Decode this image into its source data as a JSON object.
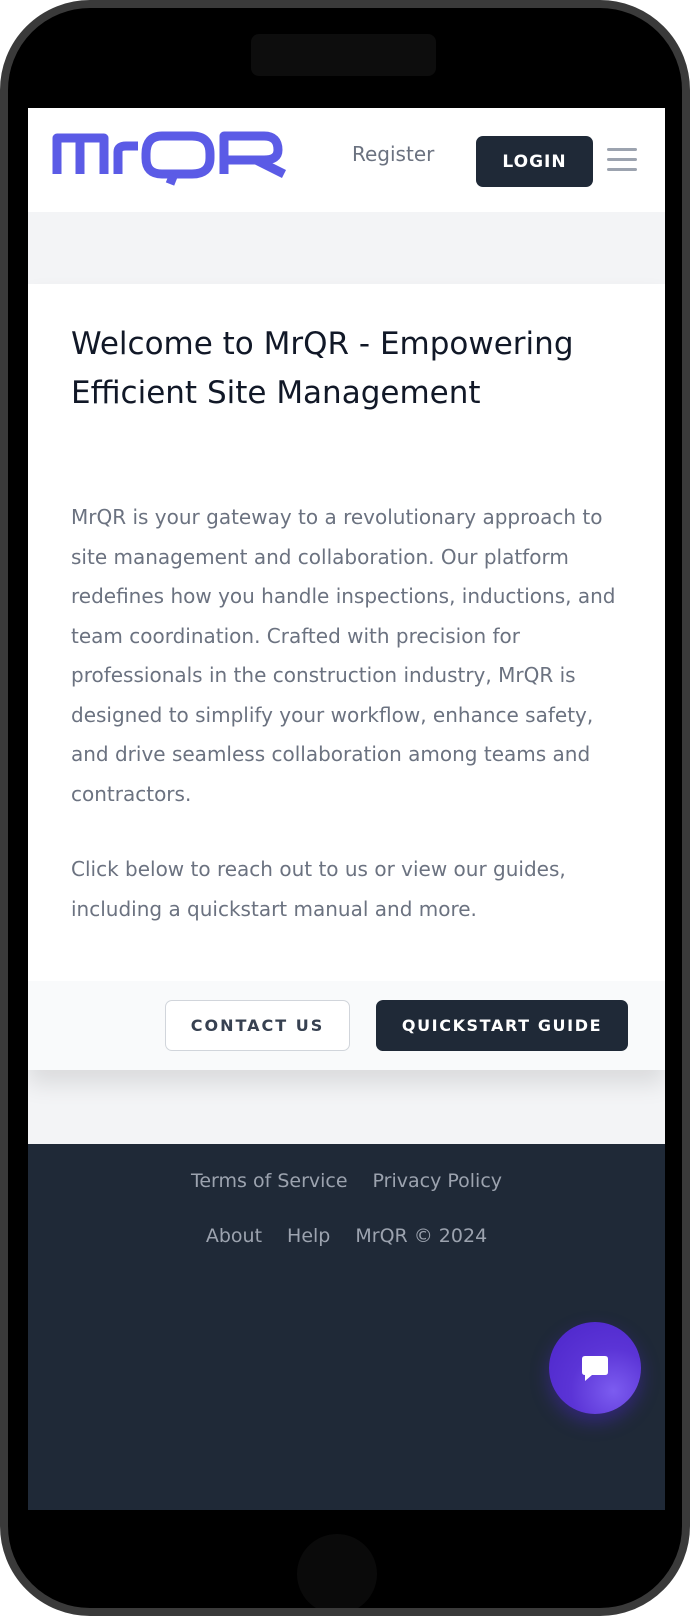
{
  "header": {
    "logo_text": "MrQR",
    "register_label": "Register",
    "login_label": "LOGIN",
    "menu_icon": "hamburger-menu-icon"
  },
  "card": {
    "title": "Welcome to MrQR - Empowering Efficient Site Management",
    "body": "MrQR is your gateway to a revolutionary approach to site management and collaboration. Our platform redefines how you handle inspections, inductions, and team coordination. Crafted with precision for professionals in the construction industry, MrQR is designed to simplify your workflow, enhance safety, and drive seamless collaboration among teams and contractors.",
    "cta_text": "Click below to reach out to us or view our guides, including a quickstart manual and more.",
    "contact_label": "CONTACT US",
    "quickstart_label": "QUICKSTART GUIDE"
  },
  "footer": {
    "links_row1": [
      "Terms of Service",
      "Privacy Policy"
    ],
    "links_row2": [
      "About",
      "Help"
    ],
    "copyright": "MrQR © 2024"
  },
  "chat": {
    "icon": "chat-bubble-icon"
  },
  "colors": {
    "brand": "#5b5be6",
    "dark": "#1f2937",
    "muted_text": "#6b7280",
    "chat_purple": "#5b34d6"
  }
}
